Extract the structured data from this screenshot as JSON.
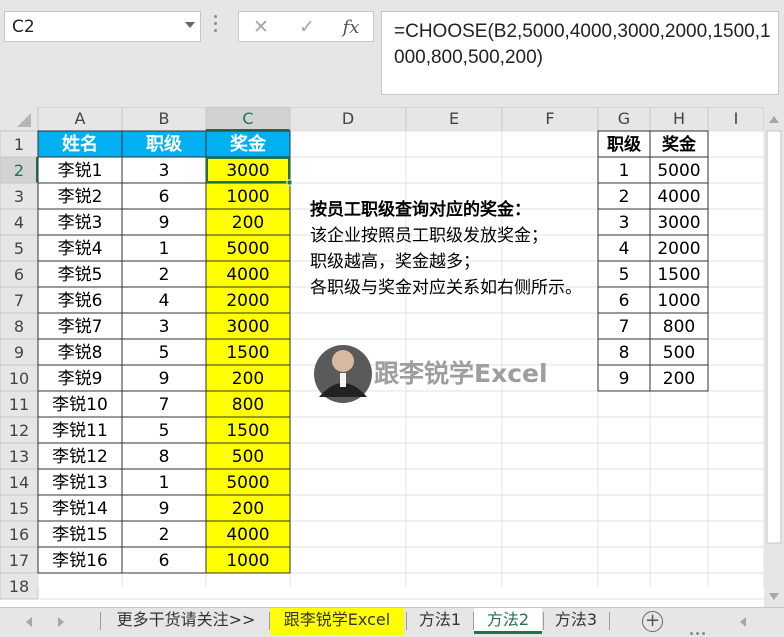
{
  "namebox": {
    "value": "C2"
  },
  "formula": {
    "text": "=CHOOSE(B2,5000,4000,3000,2000,1500,1000,800,500,200)"
  },
  "columns": [
    "A",
    "B",
    "C",
    "D",
    "E",
    "F",
    "G",
    "H",
    "I"
  ],
  "row_numbers": [
    "1",
    "2",
    "3",
    "4",
    "5",
    "6",
    "7",
    "8",
    "9",
    "10",
    "11",
    "12",
    "13",
    "14",
    "15",
    "16",
    "17",
    "18"
  ],
  "main_table": {
    "headers": [
      "姓名",
      "职级",
      "奖金"
    ],
    "rows": [
      [
        "李锐1",
        "3",
        "3000"
      ],
      [
        "李锐2",
        "6",
        "1000"
      ],
      [
        "李锐3",
        "9",
        "200"
      ],
      [
        "李锐4",
        "1",
        "5000"
      ],
      [
        "李锐5",
        "2",
        "4000"
      ],
      [
        "李锐6",
        "4",
        "2000"
      ],
      [
        "李锐7",
        "3",
        "3000"
      ],
      [
        "李锐8",
        "5",
        "1500"
      ],
      [
        "李锐9",
        "9",
        "200"
      ],
      [
        "李锐10",
        "7",
        "800"
      ],
      [
        "李锐11",
        "5",
        "1500"
      ],
      [
        "李锐12",
        "8",
        "500"
      ],
      [
        "李锐13",
        "1",
        "5000"
      ],
      [
        "李锐14",
        "9",
        "200"
      ],
      [
        "李锐15",
        "2",
        "4000"
      ],
      [
        "李锐16",
        "6",
        "1000"
      ]
    ]
  },
  "lookup_table": {
    "headers": [
      "职级",
      "奖金"
    ],
    "rows": [
      [
        "1",
        "5000"
      ],
      [
        "2",
        "4000"
      ],
      [
        "3",
        "3000"
      ],
      [
        "4",
        "2000"
      ],
      [
        "5",
        "1500"
      ],
      [
        "6",
        "1000"
      ],
      [
        "7",
        "800"
      ],
      [
        "8",
        "500"
      ],
      [
        "9",
        "200"
      ]
    ]
  },
  "notes": {
    "title": "按员工职级查询对应的奖金：",
    "lines": [
      "该企业按照员工职级发放奖金；",
      "职级越高，奖金越多；",
      "各职级与奖金对应关系如右侧所示。"
    ]
  },
  "watermark": {
    "text": "跟李锐学Excel"
  },
  "sheet_tabs": [
    "更多干货请关注>>",
    "跟李锐学Excel",
    "方法1",
    "方法2",
    "方法3"
  ],
  "active_tab": "方法2",
  "colors": {
    "header_fill": "#00b0f0",
    "bonus_fill": "#ffff00",
    "selected_header": "#d2d2d2",
    "active_tab": "#217346"
  }
}
